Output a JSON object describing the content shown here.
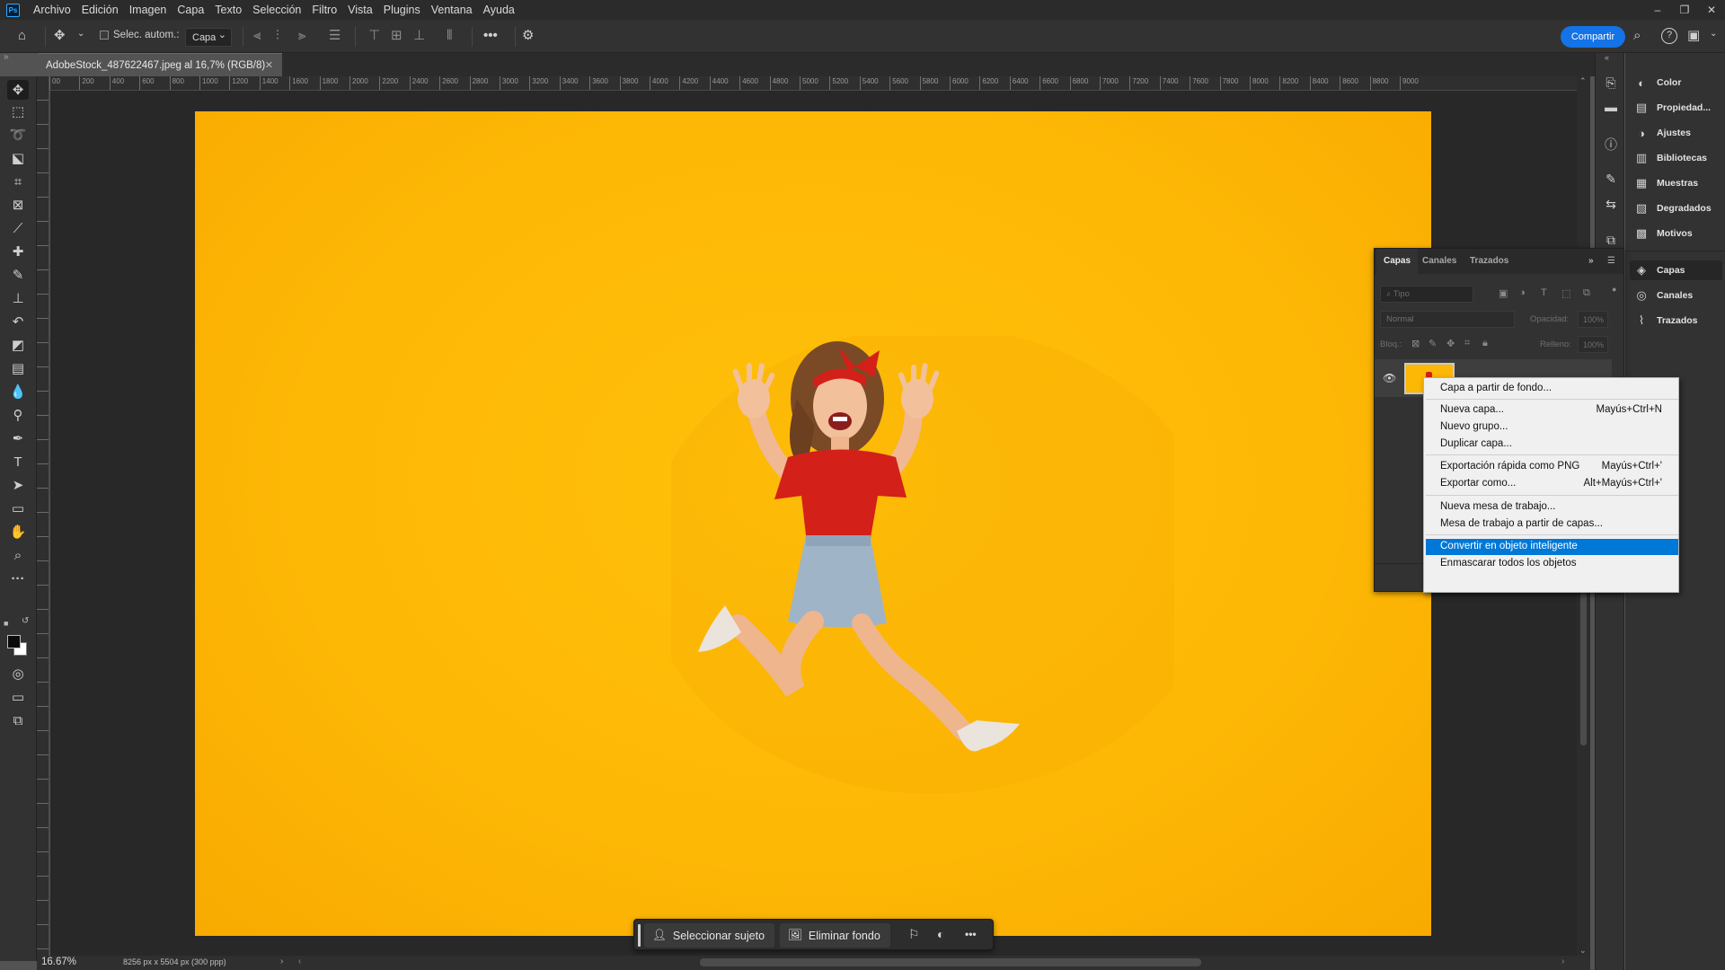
{
  "app": {
    "logo": "Ps"
  },
  "menu": [
    "Archivo",
    "Edición",
    "Imagen",
    "Capa",
    "Texto",
    "Selección",
    "Filtro",
    "Vista",
    "Plugins",
    "Ventana",
    "Ayuda"
  ],
  "options": {
    "auto_select_label": "Selec. autom.:",
    "auto_select_checked": false,
    "target_value": "Capa",
    "share_label": "Compartir"
  },
  "document": {
    "tab_title": "AdobeStock_487622467.jpeg al 16,7% (RGB/8)",
    "zoom": "16.67%",
    "size_info": "8256 px x 5504 px (300 ppp)"
  },
  "ruler_labels": [
    "00",
    "200",
    "400",
    "600",
    "800",
    "1000",
    "1200",
    "1400",
    "1600",
    "1800",
    "2000",
    "2200",
    "2400",
    "2600",
    "2800",
    "3000",
    "3200",
    "3400",
    "3600",
    "3800",
    "4000",
    "4200",
    "4400",
    "4600",
    "4800",
    "5000",
    "5200",
    "5400",
    "5600",
    "5800",
    "6000",
    "6200",
    "6400",
    "6600",
    "6800",
    "7000",
    "7200",
    "7400",
    "7600",
    "7800",
    "8000",
    "8200",
    "8400",
    "8600",
    "8800",
    "9000"
  ],
  "right_panels": [
    {
      "label": "Color",
      "icon": "color-wheel-icon"
    },
    {
      "label": "Propiedad...",
      "icon": "properties-icon"
    },
    {
      "label": "Ajustes",
      "icon": "adjustments-icon"
    },
    {
      "label": "Bibliotecas",
      "icon": "libraries-icon"
    },
    {
      "label": "Muestras",
      "icon": "swatches-grid-icon"
    },
    {
      "label": "Degradados",
      "icon": "gradients-icon"
    },
    {
      "label": "Motivos",
      "icon": "patterns-icon"
    },
    {
      "label": "Capas",
      "icon": "layers-icon"
    },
    {
      "label": "Canales",
      "icon": "channels-icon"
    },
    {
      "label": "Trazados",
      "icon": "paths-icon"
    }
  ],
  "layers_panel": {
    "tabs": [
      "Capas",
      "Canales",
      "Trazados"
    ],
    "active_tab": "Capas",
    "filter_placeholder": "Tipo",
    "blend_mode": "Normal",
    "opacity_label": "Opacidad:",
    "opacity_value": "100%",
    "lock_label": "Bloq.:",
    "fill_label": "Relleno:",
    "fill_value": "100%"
  },
  "context_menu": [
    {
      "label": "Capa a partir de fondo...",
      "shortcut": ""
    },
    {
      "label": "Nueva capa...",
      "shortcut": "Mayús+Ctrl+N"
    },
    {
      "label": "Nuevo grupo...",
      "shortcut": ""
    },
    {
      "label": "Duplicar capa...",
      "shortcut": ""
    },
    {
      "label": "Exportación rápida como PNG",
      "shortcut": "Mayús+Ctrl+'"
    },
    {
      "label": "Exportar como...",
      "shortcut": "Alt+Mayús+Ctrl+'"
    },
    {
      "label": "Nueva mesa de trabajo...",
      "shortcut": ""
    },
    {
      "label": "Mesa de trabajo a partir de capas...",
      "shortcut": ""
    },
    {
      "label": "Convertir en objeto inteligente",
      "shortcut": "",
      "highlighted": true
    },
    {
      "label": "Enmascarar todos los objetos",
      "shortcut": ""
    }
  ],
  "taskbar": {
    "select_subject": "Seleccionar sujeto",
    "remove_background": "Eliminar fondo"
  },
  "colors": {
    "canvas_background": "#fdb705",
    "accent_blue": "#1473e6",
    "menu_highlight": "#0078d7",
    "shirt_red": "#d32018"
  }
}
